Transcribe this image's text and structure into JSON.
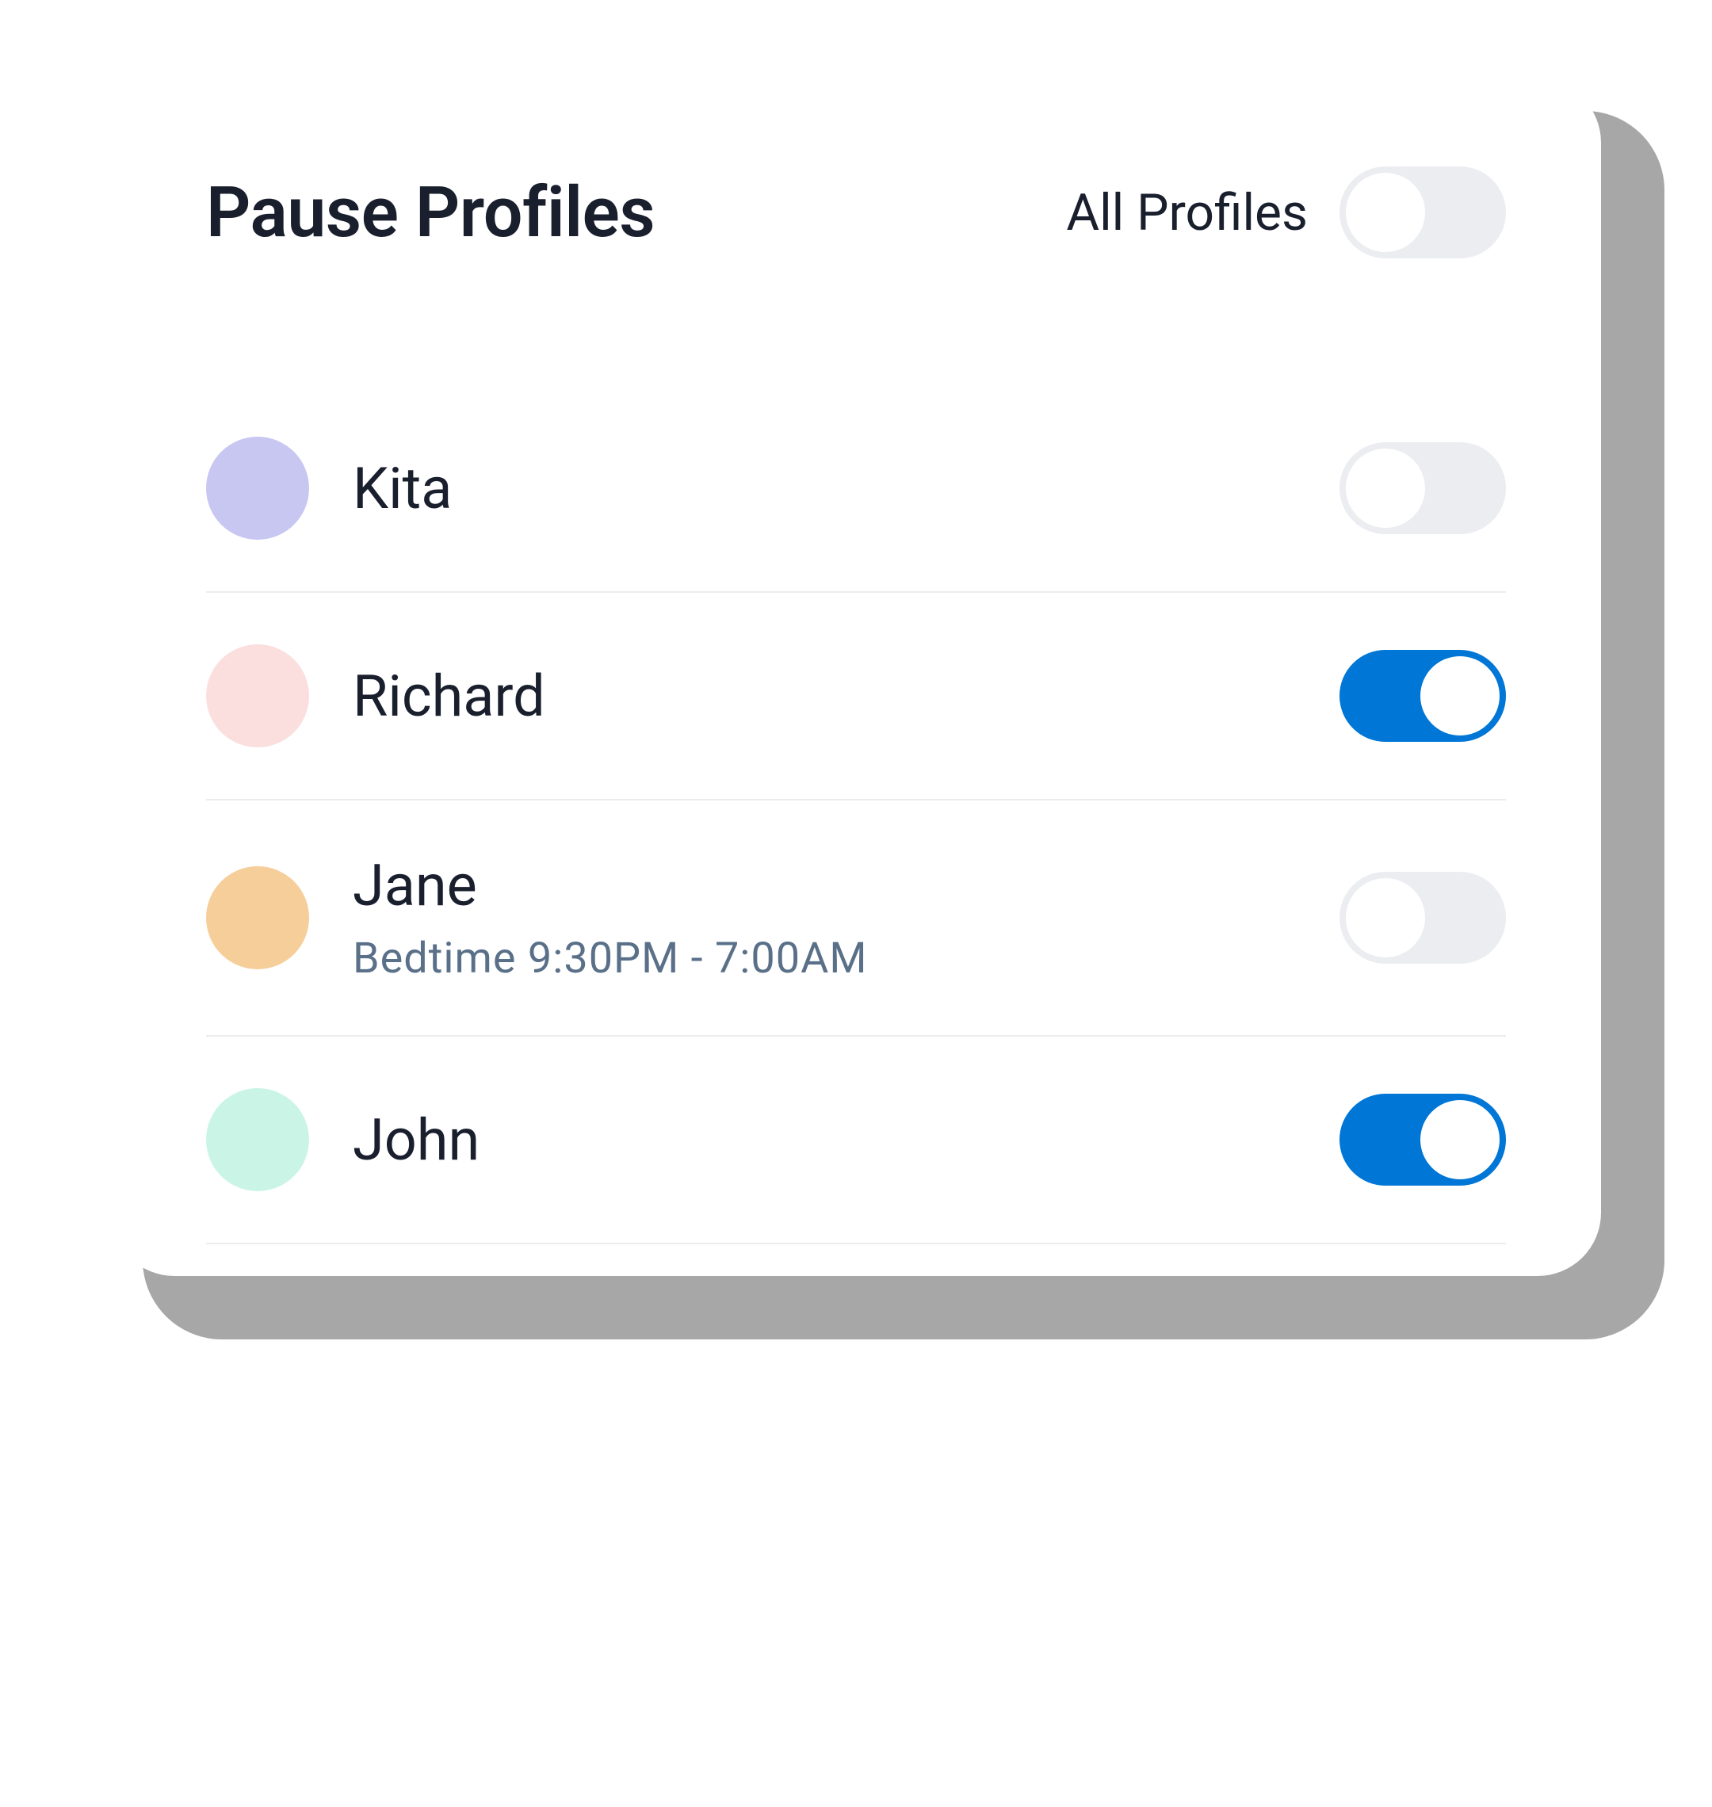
{
  "header": {
    "title": "Pause Profiles",
    "all_profiles_label": "All Profiles",
    "all_profiles_toggle": false
  },
  "profiles": [
    {
      "name": "Kita",
      "avatar_color": "#c7c7f2",
      "subtitle": "",
      "toggle": false
    },
    {
      "name": "Richard",
      "avatar_color": "#fbdede",
      "subtitle": "",
      "toggle": true
    },
    {
      "name": "Jane",
      "avatar_color": "#f6ce9a",
      "subtitle": "Bedtime 9:30PM - 7:00AM",
      "toggle": false
    },
    {
      "name": "John",
      "avatar_color": "#caf5e6",
      "subtitle": "",
      "toggle": true
    }
  ]
}
